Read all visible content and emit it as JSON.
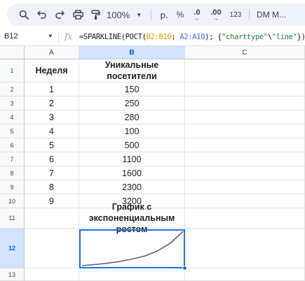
{
  "toolbar": {
    "zoom": "100%",
    "format_currency": "р.",
    "format_percent": "%",
    "decrease_decimals": ".0",
    "increase_decimals": ".00",
    "more_formats": "123",
    "font": "DM M..."
  },
  "formula_bar": {
    "cell_ref": "B12",
    "fx": "fx",
    "formula_start": "=SPARKLINE(РОСТ(",
    "ref1": "B2:B10",
    "sep": "; ",
    "ref2": "A2:A10",
    "formula_mid": "); {",
    "str1": "\"charttype\"",
    "formula_bs": "\\",
    "str2": "\"line\"",
    "formula_end": "})"
  },
  "columns": [
    "A",
    "B",
    "C"
  ],
  "rows": [
    {
      "num": "1",
      "a": "Неделя",
      "b": "Уникальные посетители"
    },
    {
      "num": "2",
      "a": "1",
      "b": "150"
    },
    {
      "num": "3",
      "a": "2",
      "b": "250"
    },
    {
      "num": "4",
      "a": "3",
      "b": "280"
    },
    {
      "num": "5",
      "a": "4",
      "b": "100"
    },
    {
      "num": "6",
      "a": "5",
      "b": "500"
    },
    {
      "num": "7",
      "a": "6",
      "b": "1100"
    },
    {
      "num": "8",
      "a": "7",
      "b": "1600"
    },
    {
      "num": "9",
      "a": "8",
      "b": "2300"
    },
    {
      "num": "10",
      "a": "9",
      "b": "3200"
    },
    {
      "num": "11",
      "a": "",
      "b": "График с экспоненциальным ростом"
    },
    {
      "num": "12",
      "a": "",
      "b": ""
    },
    {
      "num": "13",
      "a": "",
      "b": ""
    }
  ],
  "sparkline": {
    "type": "line",
    "color": "#5f6368",
    "values": [
      25,
      35,
      48,
      65,
      90,
      120,
      170,
      245,
      360
    ]
  }
}
